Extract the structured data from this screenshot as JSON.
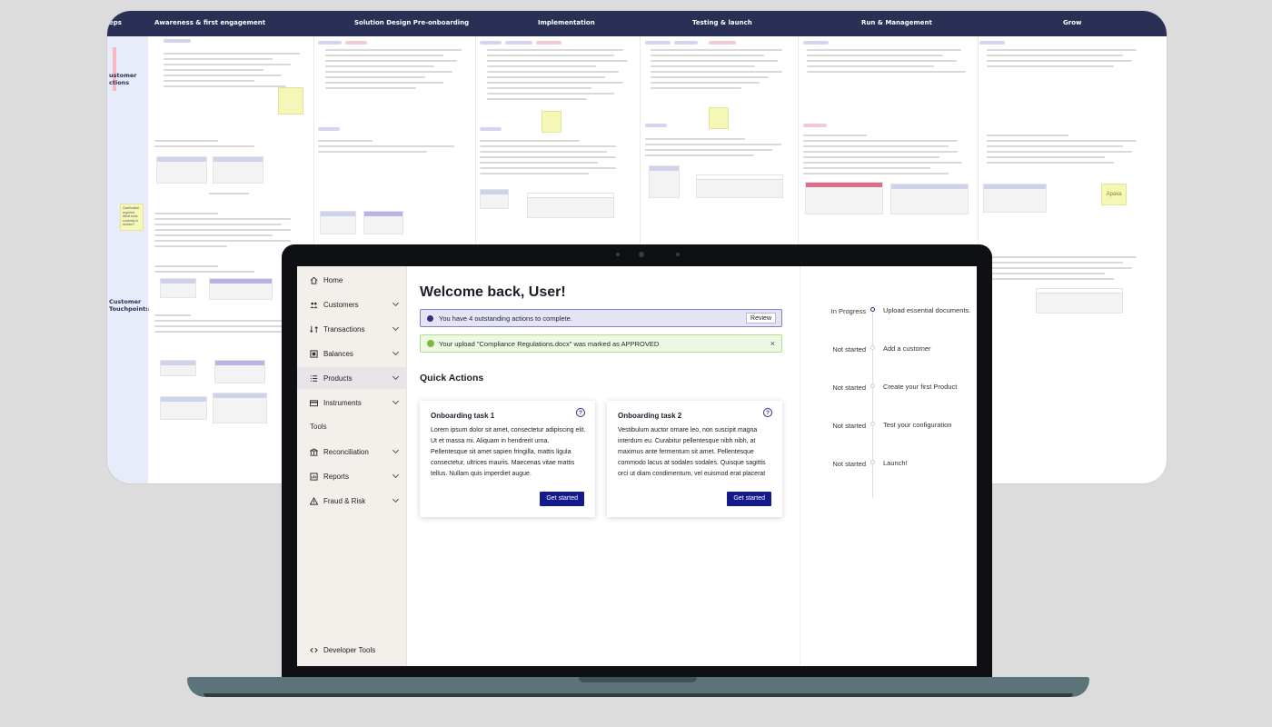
{
  "board": {
    "columns": [
      "eps",
      "Awareness & first engagement",
      "Solution Design Pre-onboarding",
      "Implementation",
      "Testing & launch",
      "Run & Management",
      "Grow"
    ],
    "row_labels": {
      "actions": "ustomer\nctions",
      "touchpoints": "Customer\nTouchpoints"
    },
    "note_text": "Clarification\nrequired\nWhat tools\ncurrently in\nservice?",
    "brand_note": "Apaxa",
    "colors": {
      "header": "#2a2f55",
      "note": "#f4f7b6"
    }
  },
  "app": {
    "sidebar": {
      "items": [
        {
          "label": "Home",
          "icon": "home-icon",
          "chevron": false
        },
        {
          "label": "Customers",
          "icon": "users-icon",
          "chevron": true
        },
        {
          "label": "Transactions",
          "icon": "transactions-icon",
          "chevron": true
        },
        {
          "label": "Balances",
          "icon": "balances-icon",
          "chevron": true
        },
        {
          "label": "Products",
          "icon": "list-icon",
          "chevron": true,
          "active": true
        },
        {
          "label": "Instruments",
          "icon": "card-icon",
          "chevron": true
        }
      ],
      "tools_label": "Tools",
      "tools_items": [
        {
          "label": "Reconciliation",
          "icon": "bank-icon",
          "chevron": true
        },
        {
          "label": "Reports",
          "icon": "report-icon",
          "chevron": true
        },
        {
          "label": "Fraud & Risk",
          "icon": "warning-icon",
          "chevron": true
        }
      ],
      "footer_item": "Developer Tools"
    },
    "main": {
      "title": "Welcome back, User!",
      "info_alert": {
        "text": "You have 4 outstanding actions to complete.",
        "button": "Review"
      },
      "success_alert": {
        "text": "Your upload \"Compliance Regulations.docx\" was marked as APPROVED",
        "close": "×"
      },
      "quick_actions_title": "Quick Actions",
      "cards": [
        {
          "title": "Onboarding task 1",
          "help": "?",
          "body": "Lorem ipsum dolor sit amet, consectetur adipiscing elit. Ut et massa mi. Aliquam in hendrerit urna. Pellentesque sit amet sapien fringilla, mattis ligula consectetur, ultrices mauris. Maecenas vitae mattis tellus. Nullam quis imperdiet augue.",
          "button": "Get started"
        },
        {
          "title": "Onboarding task 2",
          "help": "?",
          "body": "Vestibulum auctor ornare leo, non suscipit magna interdum eu. Curabitur pellentesque nibh nibh, at maximus ante fermentum sit amet. Pellentesque commodo lacus at sodales sodales. Quisque sagittis orci ut diam condimentum, vel euismod erat placerat",
          "button": "Get started"
        }
      ]
    },
    "tracker": {
      "steps": [
        {
          "status": "In Progress",
          "label": "Upload essential documents.",
          "current": true
        },
        {
          "status": "Not started",
          "label": "Add a customer"
        },
        {
          "status": "Not started",
          "label": "Create your first Product"
        },
        {
          "status": "Not started",
          "label": "Test your configuration"
        },
        {
          "status": "Not started",
          "label": "Launch!"
        }
      ]
    },
    "colors": {
      "primary": "#131a8c",
      "success": "#7cba3f",
      "info_bg": "#e4e4f3",
      "sidebar_bg": "#f3f0ec"
    }
  }
}
